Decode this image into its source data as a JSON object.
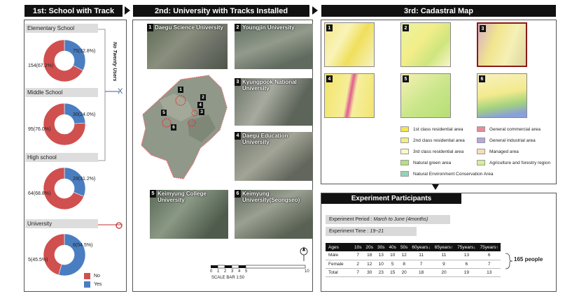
{
  "headers": {
    "h1": "1st: School with Track",
    "h2": "2nd: University with Tracks Installed",
    "h3": "3rd: Cadastral Map"
  },
  "section1": {
    "levels": [
      {
        "name": "Elementary School",
        "no_label": "154(67.2%)",
        "yes_label": "75(32.8%)",
        "yes_pct": 32.8
      },
      {
        "name": "Middle School",
        "no_label": "95(76.0%)",
        "yes_label": "30(24.0%)",
        "yes_pct": 24.0
      },
      {
        "name": "High school",
        "no_label": "64(68.8%)",
        "yes_label": "29(31.2%)",
        "yes_pct": 31.2
      },
      {
        "name": "University",
        "no_label": "5(45.5%)",
        "yes_label": "6(54.5%)",
        "yes_pct": 54.5
      }
    ],
    "side_text": "No Twenty Users",
    "mark_x": "X",
    "legend_no": "No",
    "legend_yes": "Yes",
    "color_no": "#d0504f",
    "color_yes": "#4a7ec1"
  },
  "section2": {
    "universities": [
      {
        "num": "1",
        "name": "Daegu Science University"
      },
      {
        "num": "2",
        "name": "Youngjin University"
      },
      {
        "num": "3",
        "name": "Kyungpook National University"
      },
      {
        "num": "4",
        "name": "Daegu Education University"
      },
      {
        "num": "5",
        "name": "Keimyung College University"
      },
      {
        "num": "6",
        "name": "Keimyung University(Seongseo)"
      }
    ],
    "scale_ticks": [
      "0",
      "1",
      "2",
      "3",
      "4",
      "5",
      "10"
    ],
    "scale_bar": "SCALE BAR 1:50",
    "north_label": "N"
  },
  "section3": {
    "map_nums": [
      "1",
      "2",
      "3",
      "4",
      "5",
      "6"
    ],
    "legend": [
      {
        "label": "1st class residential area",
        "color": "#f7e54b"
      },
      {
        "label": "General commercial area",
        "color": "#e98b9a"
      },
      {
        "label": "2nd class residential area",
        "color": "#f3ee8a"
      },
      {
        "label": "General industrial area",
        "color": "#b7a6de"
      },
      {
        "label": "3rd class residential area",
        "color": "#fbf7c6"
      },
      {
        "label": "Managed area",
        "color": "#f5deb8"
      },
      {
        "label": "Natural green area",
        "color": "#b6e07a"
      },
      {
        "label": "Agriculture and forestry region",
        "color": "#d6ef9a"
      },
      {
        "label": "Natural Environment Conservation Area",
        "color": "#8fd6b8"
      }
    ]
  },
  "experiment": {
    "title": "Experiment Participants",
    "period_label": "Experiment Period :",
    "period_value": "March to June (4months)",
    "time_label": "Experiment Time :",
    "time_value": "19~21",
    "table": {
      "header": [
        "Ages",
        "10s",
        "20s",
        "30s",
        "40s",
        "50s",
        "60years↓",
        "65years↑",
        "75years↓",
        "75years↑"
      ],
      "rows": [
        [
          "Male",
          "7",
          "18",
          "13",
          "10",
          "12",
          "11",
          "11",
          "13",
          "6"
        ],
        [
          "Female",
          "2",
          "12",
          "10",
          "5",
          "8",
          "7",
          "9",
          "6",
          "7"
        ],
        [
          "Total",
          "7",
          "30",
          "23",
          "15",
          "20",
          "18",
          "20",
          "19",
          "13"
        ]
      ]
    },
    "total_people": "165 people"
  }
}
